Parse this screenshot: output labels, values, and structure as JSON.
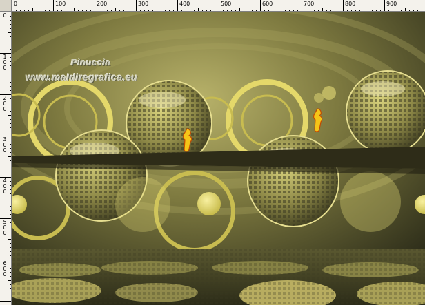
{
  "rulers": {
    "horizontal_labels": [
      "0",
      "100",
      "200",
      "300",
      "400",
      "500",
      "600",
      "700",
      "800",
      "900"
    ],
    "vertical_labels": [
      "0",
      "100",
      "200",
      "300",
      "400",
      "500",
      "600"
    ]
  },
  "artwork": {
    "watermark": {
      "name": "Pinuccia",
      "site": "www.maldiregrafica.eu"
    },
    "palette": {
      "background_dark": "#3a3a22",
      "olive": "#8f8a48",
      "gold": "#e8dc6a",
      "highlight": "#f6f0a8",
      "hand_yellow": "#f5c518",
      "hand_outline": "#c44a00"
    }
  }
}
